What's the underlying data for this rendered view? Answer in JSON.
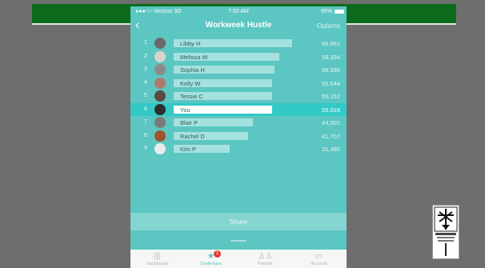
{
  "status_bar": {
    "carrier": "●●●○○ Verizon  3G",
    "time": "7:55 AM",
    "battery": "95%"
  },
  "header": {
    "back_glyph": "‹",
    "title": "Workweek Hustle",
    "options_label": "Options"
  },
  "leaderboard": [
    {
      "rank": "1",
      "name": "Libby H",
      "score": "66,661",
      "bar_fraction": 1.0,
      "avatar_color": "#6a6a6a"
    },
    {
      "rank": "2",
      "name": "Melissa W",
      "score": "59,334",
      "bar_fraction": 0.89,
      "avatar_color": "#d8d3cc"
    },
    {
      "rank": "3",
      "name": "Sophia H",
      "score": "56,596",
      "bar_fraction": 0.85,
      "avatar_color": "#8a8a8a"
    },
    {
      "rank": "4",
      "name": "Kelly W",
      "score": "55,644",
      "bar_fraction": 0.83,
      "avatar_color": "#b07a6a"
    },
    {
      "rank": "5",
      "name": "Tessie C",
      "score": "55,152",
      "bar_fraction": 0.83,
      "avatar_color": "#5a4a40"
    },
    {
      "rank": "6",
      "name": "You",
      "score": "55,018",
      "bar_fraction": 0.83,
      "avatar_color": "#2e2e2e",
      "me": true
    },
    {
      "rank": "7",
      "name": "Blair P",
      "score": "44,501",
      "bar_fraction": 0.67,
      "avatar_color": "#7a7a7a"
    },
    {
      "rank": "8",
      "name": "Rachel D",
      "score": "41,707",
      "bar_fraction": 0.63,
      "avatar_color": "#a0522d"
    },
    {
      "rank": "9",
      "name": "Kim P",
      "score": "31,480",
      "bar_fraction": 0.47,
      "avatar_color": "#e8ecef"
    }
  ],
  "share_label": "Share",
  "tabs": [
    {
      "label": "Dashboard",
      "icon": "activity-icon",
      "glyph": "·|||·"
    },
    {
      "label": "Challenges",
      "icon": "star-icon",
      "glyph": "★",
      "badge": "1",
      "active": true
    },
    {
      "label": "Friends",
      "icon": "friends-icon",
      "glyph": "♙♙"
    },
    {
      "label": "Account",
      "icon": "account-icon",
      "glyph": "▭"
    }
  ],
  "colors": {
    "accent": "#5bc6c2",
    "highlight_row": "#33c9c6",
    "top_bar": "#0b6b1a",
    "badge": "#e53935"
  }
}
